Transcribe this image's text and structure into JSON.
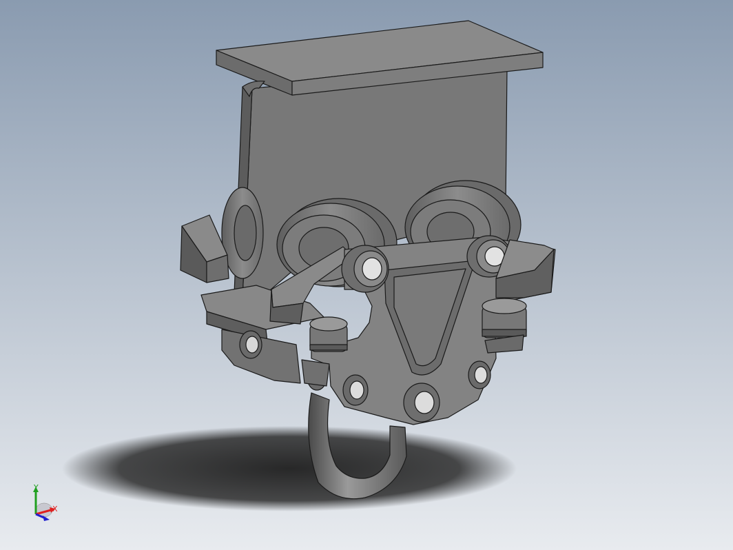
{
  "viewport": {
    "background_top": "#8a9bb0",
    "background_bottom": "#e8ebef",
    "model_color": "#7a7a7a",
    "model_edge_color": "#1a1a1a",
    "shadow_color": "#2b2b2b"
  },
  "model": {
    "parts": [
      "i-beam",
      "trolley-wheel-left",
      "trolley-wheel-center",
      "trolley-wheel-right",
      "side-plate",
      "roller-left",
      "roller-right",
      "lifting-shackle"
    ]
  },
  "triad": {
    "x_label": "X",
    "y_label": "Y",
    "x_color": "#e02020",
    "y_color": "#20a020",
    "z_color": "#2020d0"
  }
}
